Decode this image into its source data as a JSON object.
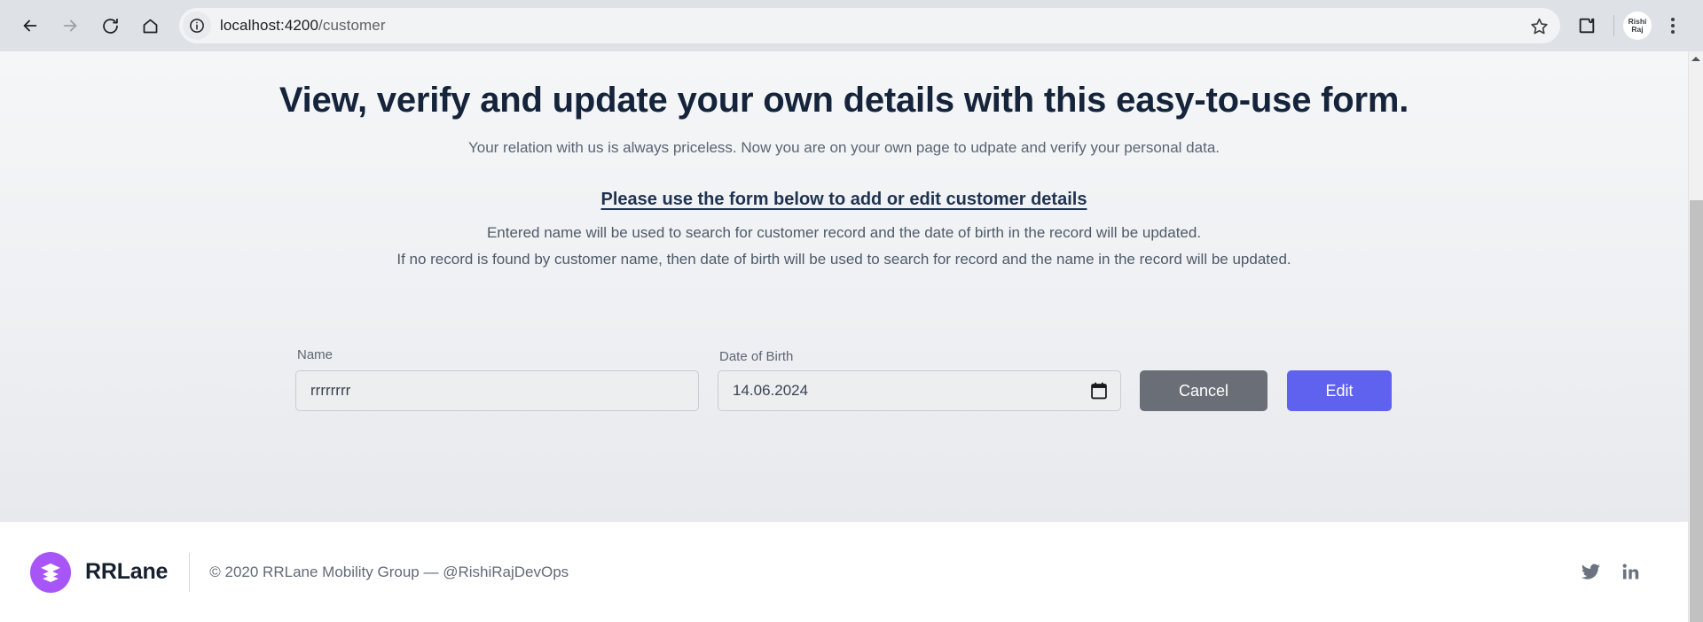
{
  "browser": {
    "back_icon": "arrow-left-icon",
    "forward_icon": "arrow-right-icon",
    "reload_icon": "reload-icon",
    "home_icon": "home-icon",
    "site_info_icon": "info-circle-icon",
    "url_host": "localhost:4200",
    "url_path": "/customer",
    "url_full": "localhost:4200/customer",
    "bookmark_icon": "star-icon",
    "extensions_icon": "puzzle-piece-icon",
    "profile_line1": "Rishi",
    "profile_line2": "Raj",
    "menu_icon": "three-dots-vertical-icon"
  },
  "page": {
    "title": "View, verify and update your own details with this easy-to-use form.",
    "subtitle": "Your relation with us is always priceless. Now you are on your own page to udpate and verify your personal data.",
    "instructions": {
      "heading": "Please use the form below to add or edit customer details",
      "line1": "Entered name will be used to search for customer record and the date of birth in the record will be updated.",
      "line2": "If no record is found by customer name, then date of birth will be used to search for record and the name in the record will be updated."
    }
  },
  "form": {
    "name_label": "Name",
    "name_value": "rrrrrrrr",
    "name_placeholder": "",
    "dob_label": "Date of Birth",
    "dob_value": "14.06.2024",
    "dob_picker_icon": "calendar-icon",
    "cancel_label": "Cancel",
    "edit_label": "Edit"
  },
  "footer": {
    "logo_icon": "stacked-layers-icon",
    "brand": "RRLane",
    "copyright": "© 2020 RRLane Mobility Group —  @RishiRajDevOps",
    "social": [
      {
        "name": "twitter-icon",
        "label": "Twitter"
      },
      {
        "name": "linkedin-icon",
        "label": "LinkedIn"
      }
    ]
  },
  "scrollbar": {
    "up_arrow_icon": "scroll-up-arrow-icon"
  },
  "colors": {
    "edit_button": "#5f61ef",
    "cancel_button": "#6a6f77",
    "brand_purple": "#a855f7",
    "heading_text": "#15243b",
    "content_bg_top": "#f4f6f8",
    "content_bg_bottom": "#e7e9ed",
    "chrome_bg": "#dee1e6",
    "social_icon": "#6b7280"
  }
}
